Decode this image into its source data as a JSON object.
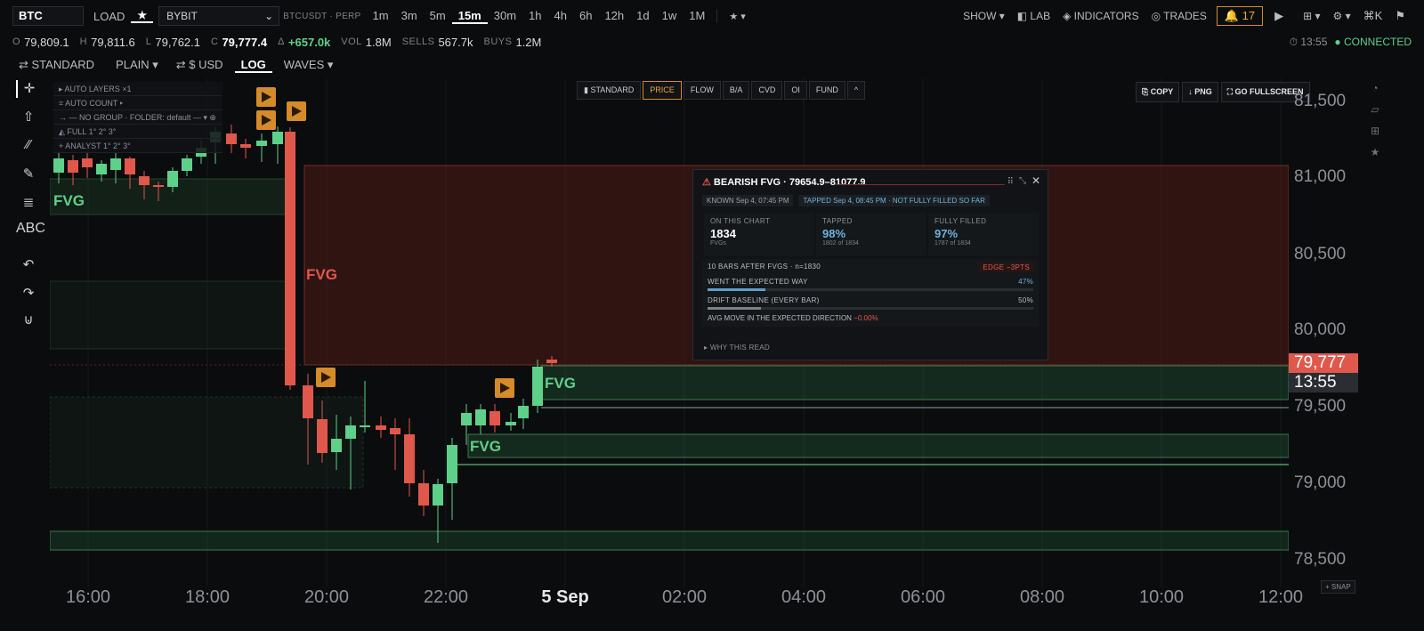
{
  "toolbar": {
    "symbol": "BTC",
    "load": "LOAD",
    "star": "★",
    "exchange": "BYBIT",
    "pair": "BTCUSDT · PERP",
    "timeframes": [
      "1m",
      "3m",
      "5m",
      "15m",
      "30m",
      "1h",
      "4h",
      "6h",
      "12h",
      "1d",
      "1w",
      "1M"
    ],
    "active_tf": "15m",
    "fav": "★ ▾",
    "show": "SHOW ▾",
    "lab": "LAB",
    "indicators": "INDICATORS",
    "trades": "TRADES",
    "alerts": "🔔 17",
    "play": "▶",
    "grid": "⊞ ▾",
    "settings": "⚙ ▾",
    "cmdk": "⌘K",
    "flag": "⚑"
  },
  "ohlc": {
    "o_label": "O",
    "o": "79,809.1",
    "h_label": "H",
    "h": "79,811.6",
    "l_label": "L",
    "l": "79,762.1",
    "c_label": "C",
    "c": "79,777.4",
    "delta_label": "Δ",
    "delta": "+657.0k",
    "vol_label": "VOL",
    "vol": "1.8M",
    "sells_label": "SELLS",
    "sells": "567.7k",
    "buys_label": "BUYS",
    "buys": "1.2M",
    "time": "⏱ 13:55",
    "status": "● CONNECTED"
  },
  "viewbar": {
    "standard": "⇄ STANDARD",
    "plain": "PLAIN ▾",
    "usd": "⇄ $ USD",
    "log": "LOG",
    "waves": "WAVES ▾"
  },
  "left_tools": [
    "✛",
    "⇧",
    "⁄⁄",
    "✎",
    "≣",
    "ABC",
    "↶",
    "↷",
    "⊍"
  ],
  "right_tools": [
    "◔",
    "▱",
    "⊞",
    "★"
  ],
  "layers": {
    "auto_layers": "▸ AUTO LAYERS ×1",
    "auto_count": "⌗ AUTO COUNT ▸",
    "group": "→ — NO GROUP · FOLDER: default — ▾ ⊕",
    "full": "◭ FULL  1°  2°  3°",
    "analyst": "+ ANALYST  1°  2°  3°"
  },
  "modes": [
    "▮ STANDARD",
    "PRICE",
    "FLOW",
    "B/A",
    "CVD",
    "OI",
    "FUND",
    "^"
  ],
  "active_mode": "PRICE",
  "actions": [
    "⎘ COPY",
    "↓ PNG",
    "⛶ GO FULLSCREEN"
  ],
  "popover": {
    "title": "BEARISH FVG · 79654.9–81077.9",
    "known": "KNOWN Sep 4, 07:45 PM",
    "tapped": "TAPPED Sep 4, 08:45 PM · NOT FULLY FILLED SO FAR",
    "stats": [
      {
        "title": "ON THIS CHART",
        "value": "1834",
        "note": "FVGs"
      },
      {
        "title": "TAPPED",
        "value": "98%",
        "note": "1802 of 1834"
      },
      {
        "title": "FULLY FILLED",
        "value": "97%",
        "note": "1787 of 1834"
      }
    ],
    "bars_after": "10 BARS AFTER FVGS · n=1830",
    "edge": "EDGE −3PTS",
    "expected": "WENT THE EXPECTED WAY",
    "expected_pct": "47%",
    "expected_val": 0.47,
    "drift": "DRIFT BASELINE (EVERY BAR)",
    "drift_pct": "50%",
    "drift_val": 0.5,
    "avg_move": "AVG MOVE IN THE EXPECTED DIRECTION",
    "avg_val": "−0.00%",
    "why": "▸ WHY THIS READ"
  },
  "price_axis": {
    "ticks": [
      "81,500",
      "81,000",
      "80,500",
      "80,000",
      "79,500",
      "79,000",
      "78,500"
    ],
    "last": "79,777",
    "countdown": "13:55",
    "last_color": "#e0584b"
  },
  "time_axis": {
    "ticks": [
      "16:00",
      "18:00",
      "20:00",
      "22:00",
      "5 Sep",
      "02:00",
      "04:00",
      "06:00",
      "08:00",
      "10:00",
      "12:00"
    ],
    "snap": "+ SNAP"
  },
  "fvg_label": "FVG",
  "colors": {
    "up": "#5fd08a",
    "down": "#e0584b",
    "accent": "#f0a640",
    "fvg_bull": "#3a7a4e",
    "fvg_bear": "#7a2e26"
  }
}
